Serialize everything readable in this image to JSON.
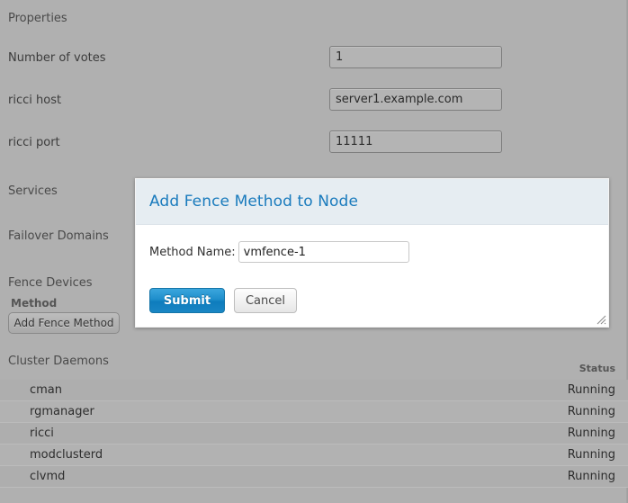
{
  "sections": {
    "properties_label": "Properties",
    "services_label": "Services",
    "failover_label": "Failover Domains",
    "fence_devices_label": "Fence Devices",
    "cluster_daemons_label": "Cluster Daemons"
  },
  "properties": {
    "fields": [
      {
        "label": "Number of votes",
        "value": "1"
      },
      {
        "label": "ricci host",
        "value": "server1.example.com"
      },
      {
        "label": "ricci port",
        "value": "11111"
      }
    ]
  },
  "fence_devices": {
    "method_header": "Method",
    "add_fence_method_button": "Add Fence Method"
  },
  "dialog": {
    "title": "Add Fence Method to Node",
    "method_name_label": "Method Name:",
    "method_name_value": "vmfence-1",
    "method_name_placeholder": "",
    "submit_label": "Submit",
    "cancel_label": "Cancel",
    "resize_grip_icon": "resize-grip-icon",
    "accent_color": "#1a7bbd",
    "titlebar_color": "#e6edf2"
  },
  "daemons": {
    "status_column_header": "Status",
    "rows": [
      {
        "name": "cman",
        "status": "Running"
      },
      {
        "name": "rgmanager",
        "status": "Running"
      },
      {
        "name": "ricci",
        "status": "Running"
      },
      {
        "name": "modclusterd",
        "status": "Running"
      },
      {
        "name": "clvmd",
        "status": "Running"
      }
    ]
  }
}
